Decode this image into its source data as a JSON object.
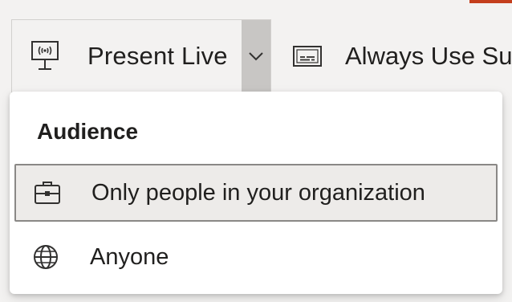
{
  "ribbon": {
    "present_live": {
      "label": "Present Live",
      "icon": "broadcast-screen-icon"
    },
    "always_use_subtitles": {
      "label": "Always Use Su",
      "icon": "subtitles-icon"
    },
    "colors": {
      "accent": "#c43e1c",
      "caret_bg": "#c8c6c4"
    }
  },
  "menu": {
    "header": "Audience",
    "items": [
      {
        "label": "Only people in your organization",
        "icon": "briefcase-icon",
        "selected": true
      },
      {
        "label": "Anyone",
        "icon": "globe-icon",
        "selected": false
      }
    ]
  }
}
